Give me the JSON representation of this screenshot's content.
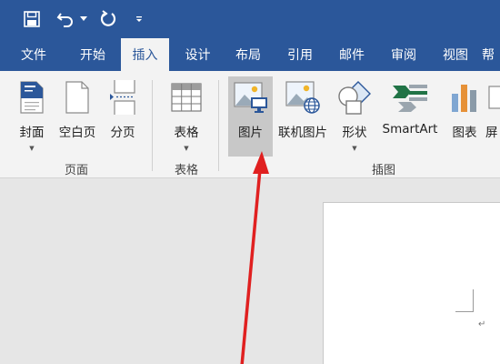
{
  "quick_access": {
    "save_icon": "save-icon",
    "undo_icon": "undo-icon",
    "undo_dropdown_icon": "chevron-down-icon",
    "redo_icon": "redo-icon",
    "customize_icon": "customize-quick-access-icon"
  },
  "tabs": [
    {
      "label": "文件"
    },
    {
      "label": "开始"
    },
    {
      "label": "插入",
      "active": true
    },
    {
      "label": "设计"
    },
    {
      "label": "布局"
    },
    {
      "label": "引用"
    },
    {
      "label": "邮件"
    },
    {
      "label": "审阅"
    },
    {
      "label": "视图"
    },
    {
      "label": "帮"
    }
  ],
  "ribbon": {
    "pages_group": {
      "label": "页面",
      "cover": {
        "label": "封面",
        "icon": "cover-page-icon"
      },
      "blank": {
        "label": "空白页",
        "icon": "blank-page-icon"
      },
      "break": {
        "label": "分页",
        "icon": "page-break-icon"
      }
    },
    "tables_group": {
      "label": "表格",
      "table": {
        "label": "表格",
        "icon": "table-icon"
      }
    },
    "illustrations_group": {
      "label": "插图",
      "pictures": {
        "label": "图片",
        "icon": "picture-icon"
      },
      "online_pictures": {
        "label": "联机图片",
        "icon": "online-picture-icon"
      },
      "shapes": {
        "label": "形状",
        "icon": "shapes-icon"
      },
      "smartart": {
        "label": "SmartArt",
        "icon": "smartart-icon"
      },
      "chart": {
        "label": "图表",
        "icon": "chart-icon"
      },
      "screenshot": {
        "label": "屏",
        "icon": "screenshot-icon"
      }
    }
  },
  "document": {
    "paragraph_mark": "↵"
  },
  "colors": {
    "brand": "#2b579a",
    "ribbon_bg": "#f3f3f3",
    "selected_button": "#c8c8c8",
    "annotation_arrow": "#e02020"
  }
}
